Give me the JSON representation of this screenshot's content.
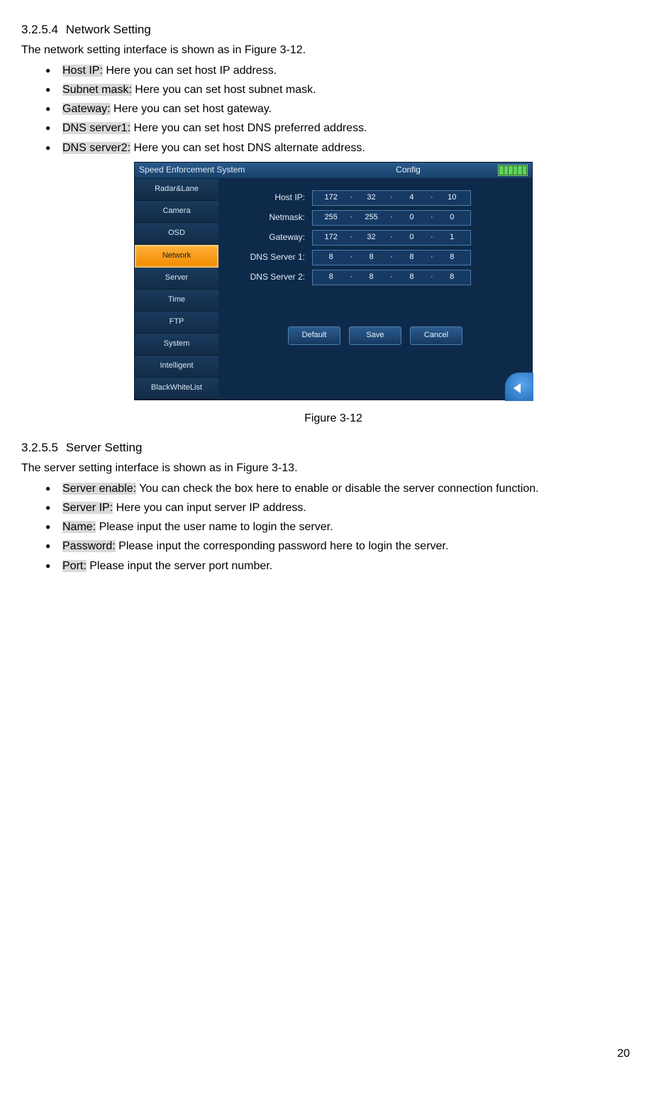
{
  "sections": {
    "network": {
      "number": "3.2.5.4",
      "title": "Network Setting",
      "intro": "The network setting interface is shown as in Figure 3-12.",
      "items": [
        {
          "term": "Host IP:",
          "desc": " Here you can set host IP address."
        },
        {
          "term": "Subnet mask:",
          "desc": " Here you can set host subnet mask."
        },
        {
          "term": "Gateway:",
          "desc": " Here you can set host gateway."
        },
        {
          "term": "DNS server1:",
          "desc": " Here you can set host DNS preferred address."
        },
        {
          "term": "DNS server2:",
          "desc": " Here you can set host DNS alternate address."
        }
      ],
      "figure_caption": "Figure 3-12"
    },
    "server": {
      "number": "3.2.5.5",
      "title": "Server Setting",
      "intro": "The server setting interface is shown as in Figure 3-13.",
      "items": [
        {
          "term": "Server enable:",
          "desc": " You can check the box here to enable or disable the server connection function."
        },
        {
          "term": "Server IP:",
          "desc": " Here you can input server IP address."
        },
        {
          "term": "Name:",
          "desc": " Please input the user name to login the server."
        },
        {
          "term": "Password:",
          "desc": " Please input the corresponding password here to login the server."
        },
        {
          "term": "Port:",
          "desc": " Please input the server port number."
        }
      ]
    }
  },
  "screenshot": {
    "top_title": "Speed Enforcement System",
    "top_center": "Config",
    "sidebar": [
      "Radar&Lane",
      "Camera",
      "OSD",
      "Network",
      "Server",
      "Time",
      "FTP",
      "System",
      "Intelligent",
      "BlackWhiteList"
    ],
    "sidebar_active_index": 3,
    "fields": {
      "hostip": {
        "label": "Host IP:",
        "oct": [
          "172",
          "32",
          "4",
          "10"
        ]
      },
      "netmask": {
        "label": "Netmask:",
        "oct": [
          "255",
          "255",
          "0",
          "0"
        ]
      },
      "gateway": {
        "label": "Gateway:",
        "oct": [
          "172",
          "32",
          "0",
          "1"
        ]
      },
      "dns1": {
        "label": "DNS Server 1:",
        "oct": [
          "8",
          "8",
          "8",
          "8"
        ]
      },
      "dns2": {
        "label": "DNS Server 2:",
        "oct": [
          "8",
          "8",
          "8",
          "8"
        ]
      }
    },
    "buttons": [
      "Default",
      "Save",
      "Cancel"
    ]
  },
  "page_number": "20"
}
